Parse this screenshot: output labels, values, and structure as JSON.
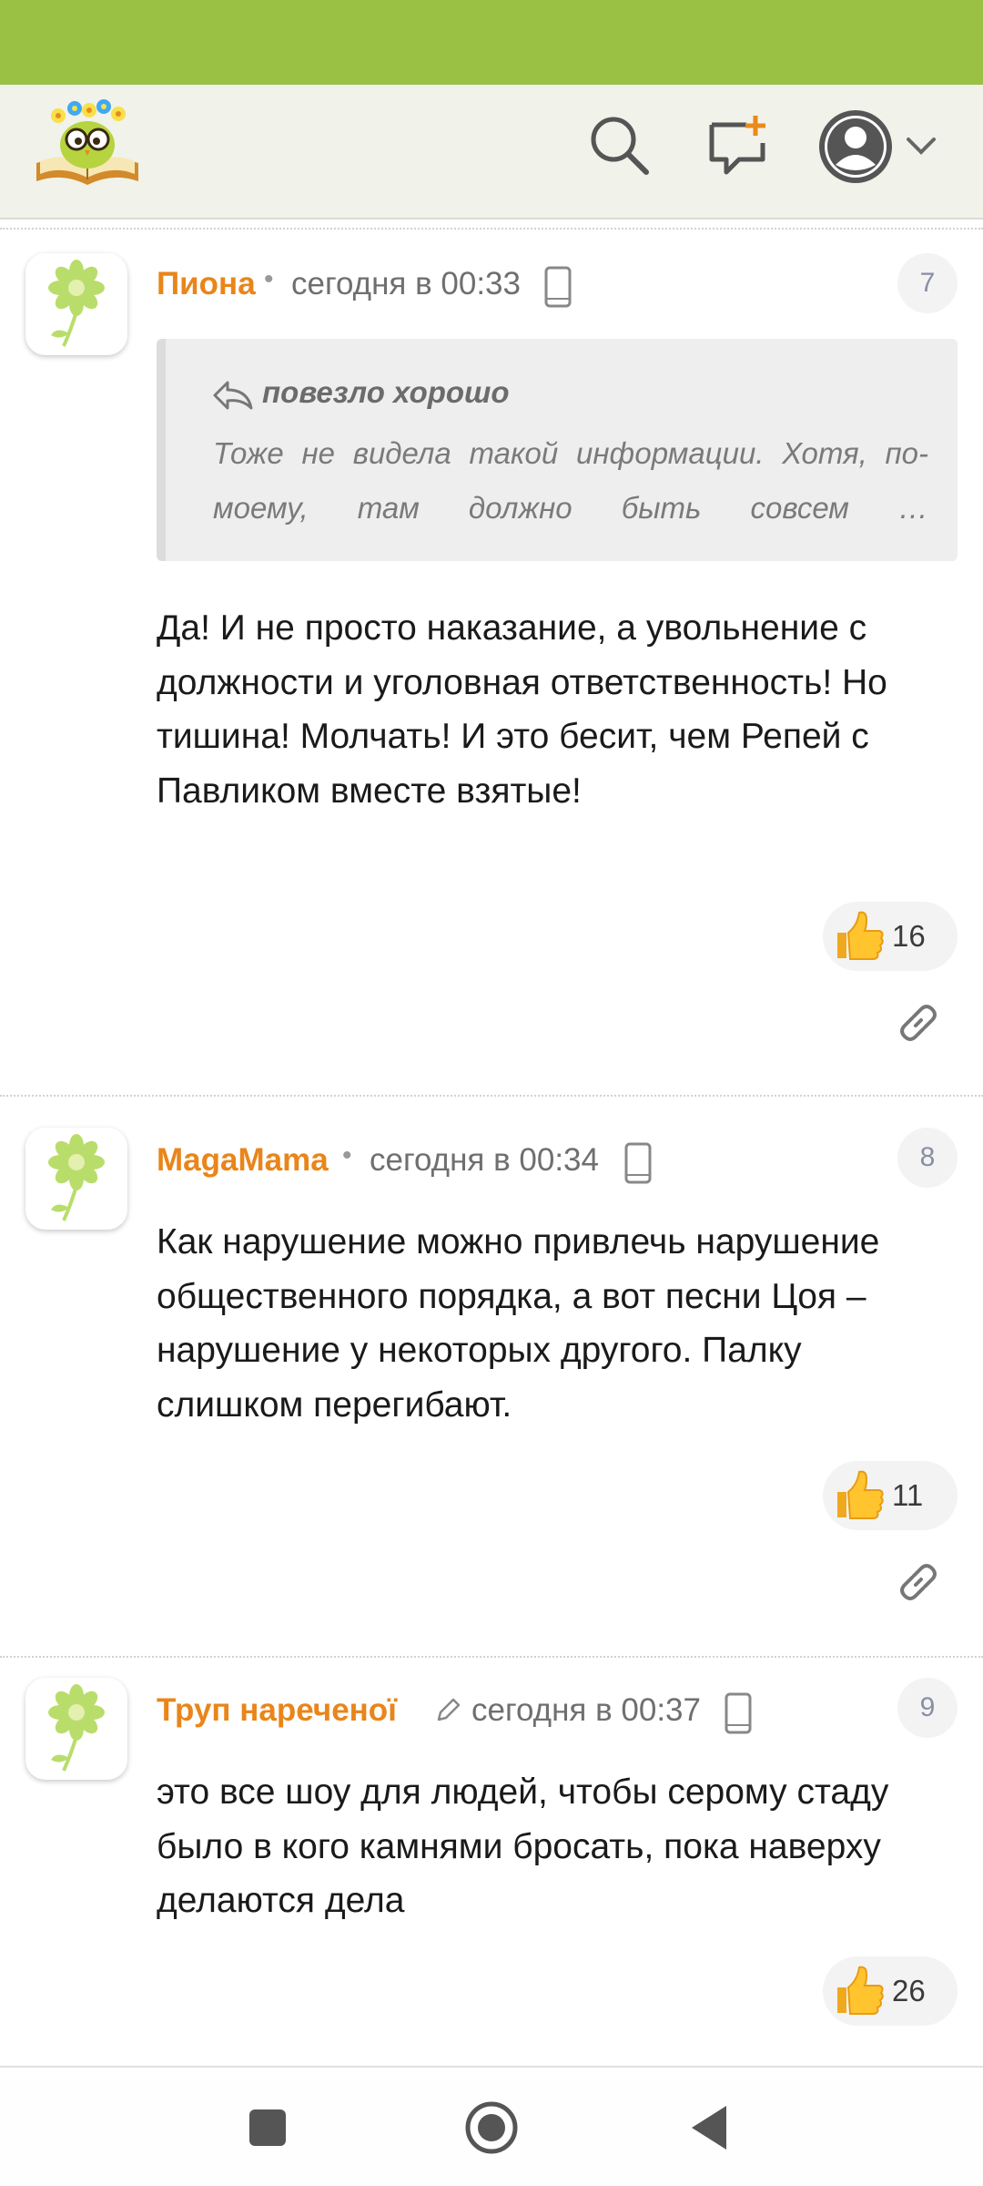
{
  "header": {
    "icons": [
      "owl-reader-logo",
      "search-icon",
      "new-post-icon",
      "user-avatar-icon",
      "chevron-down-icon"
    ]
  },
  "comments": [
    {
      "author": "Пиона",
      "timestamp": "сегодня в 00:33",
      "number": "7",
      "quote": {
        "author": "повезло хорошо",
        "text": "Тоже не видела такой информации. Хотя, по-моему, там должно быть совсем …"
      },
      "text": "Да! И не просто наказание, а увольнение с должности и уголовная ответственность! Но тишина! Молчать! И это бесит, чем Репей с Павликом вместе взятые!",
      "likes": "16"
    },
    {
      "author": "MagaMama",
      "timestamp": "сегодня в 00:34",
      "number": "8",
      "text": "Как нарушение можно привлечь нарушение общественного порядка, а вот песни Цоя – нарушение у некоторых другого. Палку слишком перегибают.",
      "likes": "11"
    },
    {
      "author": "Труп нареченої",
      "timestamp": "сегодня в 00:37",
      "number": "9",
      "edited": true,
      "text": "это все шоу для людей, чтобы серому стаду было в кого камнями бросать, пока наверху делаются дела",
      "likes": "26"
    }
  ],
  "colors": {
    "status_bar": "#9bc144",
    "header_bg": "#f1f2ea",
    "author": "#e9851a",
    "timestamp": "#6f6f6f",
    "badge_text": "#8a8ea4"
  },
  "nav": [
    "recents-button",
    "home-button",
    "back-button"
  ]
}
